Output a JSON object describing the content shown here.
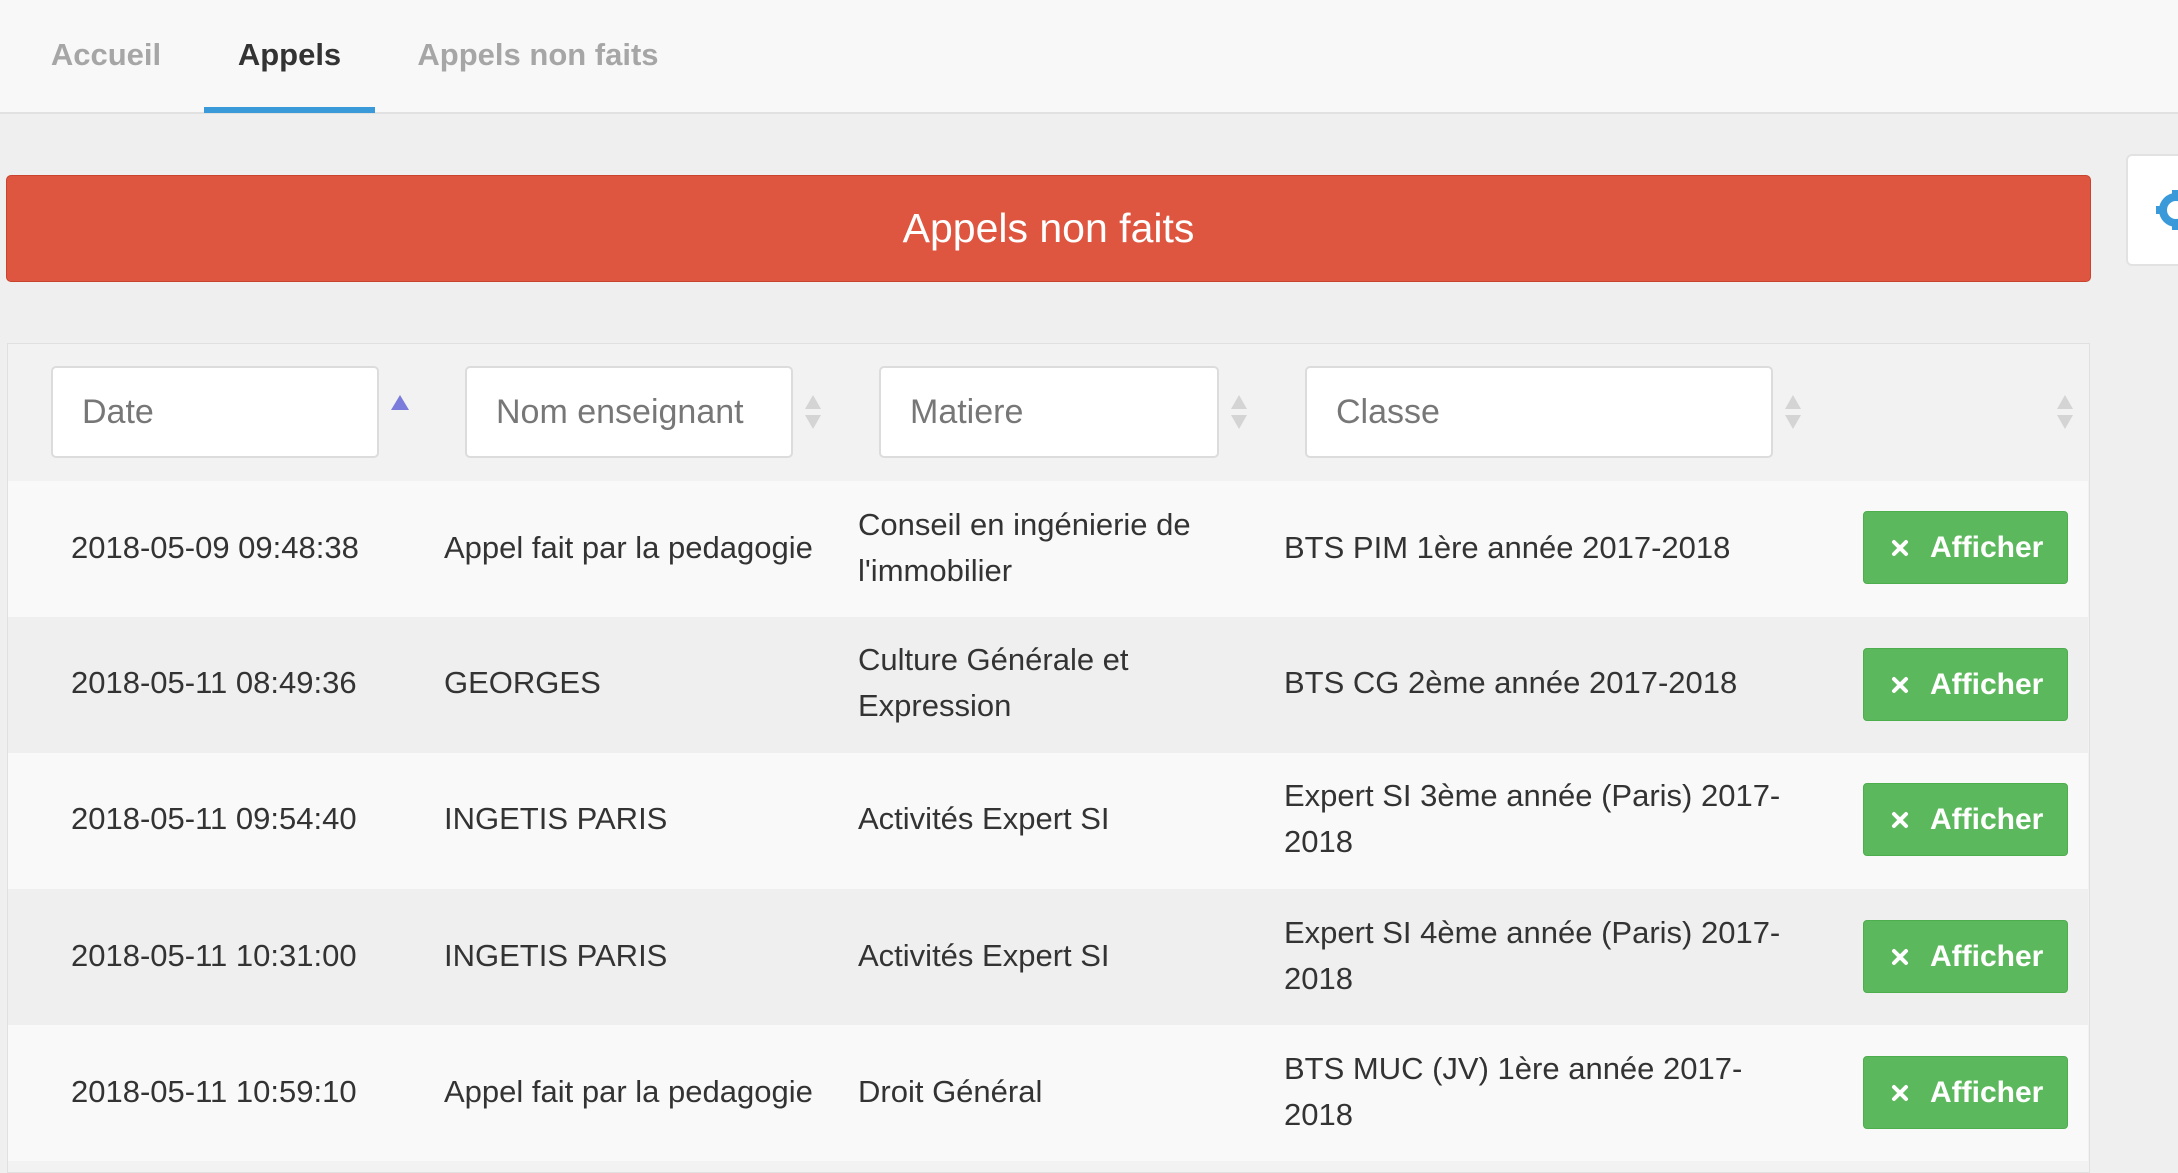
{
  "nav": {
    "tabs": [
      {
        "label": "Accueil"
      },
      {
        "label": "Appels"
      },
      {
        "label": "Appels non faits"
      }
    ],
    "active_tab": "Appels"
  },
  "banner": {
    "title": "Appels non faits"
  },
  "filters": {
    "date": "Date",
    "nom": "Nom enseignant",
    "matiere": "Matiere",
    "classe": "Classe"
  },
  "sort": {
    "date": "ascending"
  },
  "colors": {
    "banner": "#df5640",
    "button": "#5cb85c",
    "active_tab_underline": "#3a9ad9",
    "sort_active": "#7b7bdc",
    "settings_icon": "#3a9ad9"
  },
  "rows": [
    {
      "date": "2018-05-09 09:48:38",
      "nom": "Appel fait par la pedagogie",
      "matiere": [
        "Conseil en ingénierie de",
        "l'immobilier"
      ],
      "classe": [
        "BTS PIM 1ère année 2017-2018"
      ],
      "action": "Afficher"
    },
    {
      "date": "2018-05-11 08:49:36",
      "nom": "GEORGES",
      "matiere": [
        "Culture Générale et",
        "Expression"
      ],
      "classe": [
        "BTS CG 2ème année 2017-2018"
      ],
      "action": "Afficher"
    },
    {
      "date": "2018-05-11 09:54:40",
      "nom": "INGETIS PARIS",
      "matiere": [
        "Activités Expert SI"
      ],
      "classe": [
        "Expert SI 3ème année (Paris) 2017-",
        "2018"
      ],
      "action": "Afficher"
    },
    {
      "date": "2018-05-11 10:31:00",
      "nom": "INGETIS PARIS",
      "matiere": [
        "Activités Expert SI"
      ],
      "classe": [
        "Expert SI 4ème année (Paris) 2017-",
        "2018"
      ],
      "action": "Afficher"
    },
    {
      "date": "2018-05-11 10:59:10",
      "nom": "Appel fait par la pedagogie",
      "matiere": [
        "Droit Général"
      ],
      "classe": [
        "BTS MUC (JV) 1ère année 2017-",
        "2018"
      ],
      "action": "Afficher"
    }
  ],
  "icons": {
    "close": "close-icon",
    "settings": "gear-icon",
    "sort": "sort-icon"
  }
}
